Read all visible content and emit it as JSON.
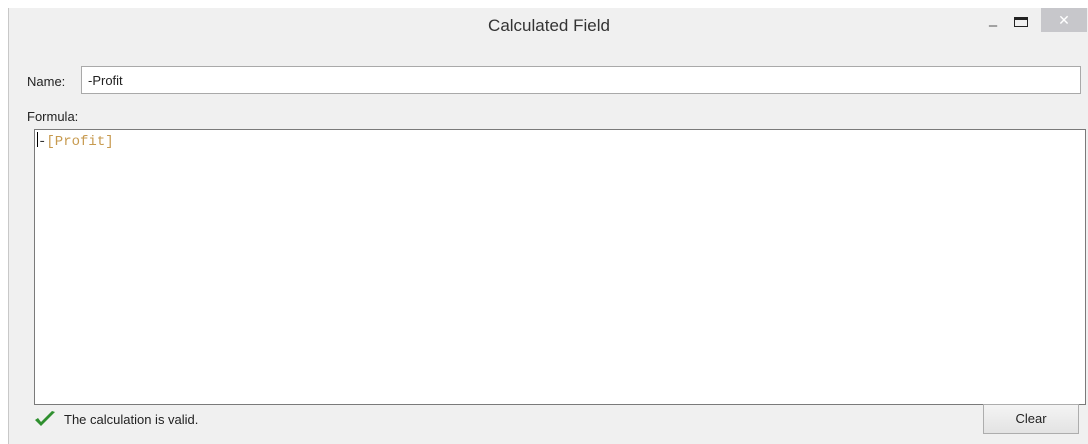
{
  "window": {
    "title": "Calculated Field",
    "minimize_glyph": "–",
    "close_glyph": "✕"
  },
  "form": {
    "name_label": "Name:",
    "name_value": "-Profit",
    "formula_label": "Formula:",
    "formula_operator": "-",
    "formula_field": "[Profit]"
  },
  "status": {
    "icon": "checkmark-icon",
    "icon_color": "#2f8f2f",
    "text": "The calculation is valid."
  },
  "actions": {
    "clear_label": "Clear"
  },
  "colors": {
    "field_reference": "#c79a4f",
    "close_button_bg": "#c7c7cb"
  }
}
